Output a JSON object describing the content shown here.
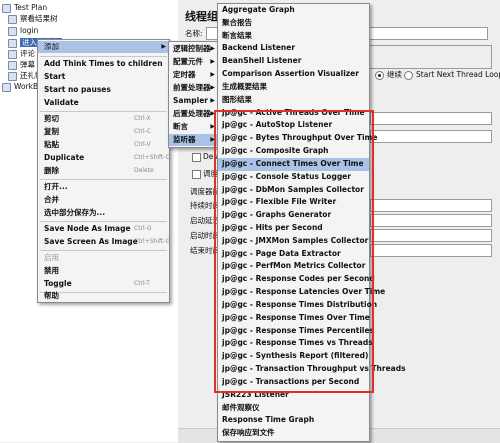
{
  "tree": {
    "items": [
      {
        "label": "Test Plan"
      },
      {
        "label": "察看结果树"
      },
      {
        "label": "login"
      },
      {
        "label": "进入购物车"
      },
      {
        "label": "评论"
      },
      {
        "label": "弹幕"
      },
      {
        "label": "还礼物"
      },
      {
        "label": "WorkBench"
      }
    ]
  },
  "thread_group": {
    "title": "线程组",
    "name_label": "名称:",
    "after_error_options": [
      "继续",
      "Start Next Thread Loop"
    ],
    "delay_label": "Delay",
    "scheduler_label": "调度",
    "scheduler_config_label": "调度器配置",
    "duration_label": "持续时间",
    "startup_delay_label": "启动延迟",
    "start_time_label": "启动时间",
    "end_time_label": "结束时间"
  },
  "context_menu": {
    "items": [
      {
        "label": "添加",
        "shortcut": "",
        "submenu": true
      },
      {
        "label": "Add Think Times to children",
        "shortcut": ""
      },
      {
        "label": "Start",
        "shortcut": ""
      },
      {
        "label": "Start no pauses",
        "shortcut": ""
      },
      {
        "label": "Validate",
        "shortcut": ""
      },
      {
        "label": "剪切",
        "shortcut": "Ctrl-X"
      },
      {
        "label": "复制",
        "shortcut": "Ctrl-C"
      },
      {
        "label": "粘贴",
        "shortcut": "Ctrl-V"
      },
      {
        "label": "Duplicate",
        "shortcut": "Ctrl+Shift-C"
      },
      {
        "label": "删除",
        "shortcut": "Delete"
      },
      {
        "label": "打开...",
        "shortcut": ""
      },
      {
        "label": "合并",
        "shortcut": ""
      },
      {
        "label": "选中部分保存为...",
        "shortcut": ""
      },
      {
        "label": "Save Node As Image",
        "shortcut": "Ctrl-G"
      },
      {
        "label": "Save Screen As Image",
        "shortcut": "Ctrl+Shift-G"
      },
      {
        "label": "启用",
        "shortcut": ""
      },
      {
        "label": "禁用",
        "shortcut": ""
      },
      {
        "label": "Toggle",
        "shortcut": "Ctrl-T"
      },
      {
        "label": "帮助",
        "shortcut": ""
      }
    ]
  },
  "add_menu": {
    "items": [
      {
        "label": "逻辑控制器"
      },
      {
        "label": "配置元件"
      },
      {
        "label": "定时器"
      },
      {
        "label": "前置处理器"
      },
      {
        "label": "Sampler"
      },
      {
        "label": "后置处理器"
      },
      {
        "label": "断言"
      },
      {
        "label": "监听器"
      }
    ]
  },
  "listener_menu": {
    "items": [
      "Aggregate Graph",
      "聚合报告",
      "断言结果",
      "Backend Listener",
      "BeanShell Listener",
      "Comparison Assertion Visualizer",
      "生成概要结果",
      "图形结果",
      "jp@gc - Active Threads Over Time",
      "jp@gc - AutoStop Listener",
      "jp@gc - Bytes Throughput Over Time",
      "jp@gc - Composite Graph",
      "jp@gc - Connect Times Over Time",
      "jp@gc - Console Status Logger",
      "jp@gc - DbMon Samples Collector",
      "jp@gc - Flexible File Writer",
      "jp@gc - Graphs Generator",
      "jp@gc - Hits per Second",
      "jp@gc - JMXMon Samples Collector",
      "jp@gc - Page Data Extractor",
      "jp@gc - PerfMon Metrics Collector",
      "jp@gc - Response Codes per Second",
      "jp@gc - Response Latencies Over Time",
      "jp@gc - Response Times Distribution",
      "jp@gc - Response Times Over Time",
      "jp@gc - Response Times Percentiles",
      "jp@gc - Response Times vs Threads",
      "jp@gc - Synthesis Report (filtered)",
      "jp@gc - Transaction Throughput vs Threads",
      "jp@gc - Transactions per Second",
      "JSR223 Listener",
      "邮件观察仪",
      "Response Time Graph",
      "保存响应到文件"
    ]
  },
  "colors": {
    "highlight": "#a9c2e6",
    "annotation_box": "#e0302a",
    "tree_selection": "#3e6cb4"
  }
}
